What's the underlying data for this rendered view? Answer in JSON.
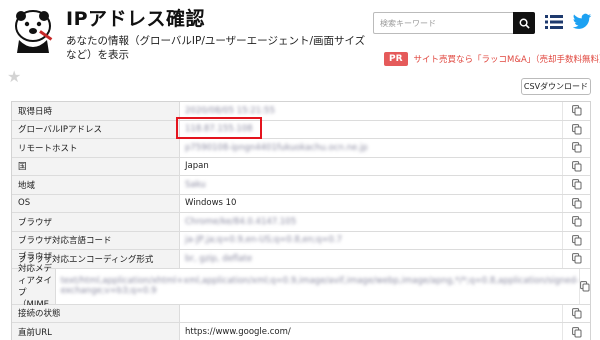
{
  "header": {
    "site_title": "IPアドレス確認",
    "subtitle": "あなたの情報（グローバルIP/ユーザーエージェント/画面サイズなど）を表示",
    "search_placeholder": "検索キーワード",
    "menu_icon": "list-icon",
    "twitter_icon": "twitter-bird-icon"
  },
  "pr": {
    "badge": "PR",
    "text": "サイト売買なら「ラッコM&A」（売却手数料無料）"
  },
  "toolbar": {
    "star_icon": "star-icon",
    "csv_label": "CSVダウンロード"
  },
  "colors": {
    "accent_red": "#e4141e",
    "pr_badge": "#e55a5a",
    "label_bg": "#f3f3f3"
  },
  "rows": [
    {
      "label": "取得日時",
      "value": "2020/08/05 15:21:55",
      "blurred": true
    },
    {
      "label": "グローバルIPアドレス",
      "value": "118.87.155.108",
      "blurred": true
    },
    {
      "label": "リモートホスト",
      "value": "p7590108-ipngn4401fukuokachu.ocn.ne.jp",
      "blurred": true
    },
    {
      "label": "国",
      "value": "Japan",
      "blurred": false
    },
    {
      "label": "地域",
      "value": "Saku",
      "blurred": true
    },
    {
      "label": "OS",
      "value": "Windows 10",
      "blurred": false
    },
    {
      "label": "ブラウザ",
      "value": "Chrome/ke/84.0.4147.105",
      "blurred": true
    },
    {
      "label": "ブラウザ対応言語コード",
      "value": "ja-JP,ja;q=0.9,en-US;q=0.8,en;q=0.7",
      "blurred": true
    },
    {
      "label": "ブラウザ対応エンコーディング形式",
      "value": "br, gzip, deflate",
      "blurred": true
    },
    {
      "label": "ブラウザ対応メディアタイプ（MIMEタイプ）",
      "value": "text/html,application/xhtml+xml,application/xml;q=0.9,image/avif,image/webp,image/apng,*/*;q=0.8,application/signed-exchange;v=b3;q=0.9",
      "blurred": true
    },
    {
      "label": "接続の状態",
      "value": "",
      "blurred": false
    },
    {
      "label": "直前URL",
      "value": "https://www.google.com/",
      "blurred": false
    }
  ]
}
